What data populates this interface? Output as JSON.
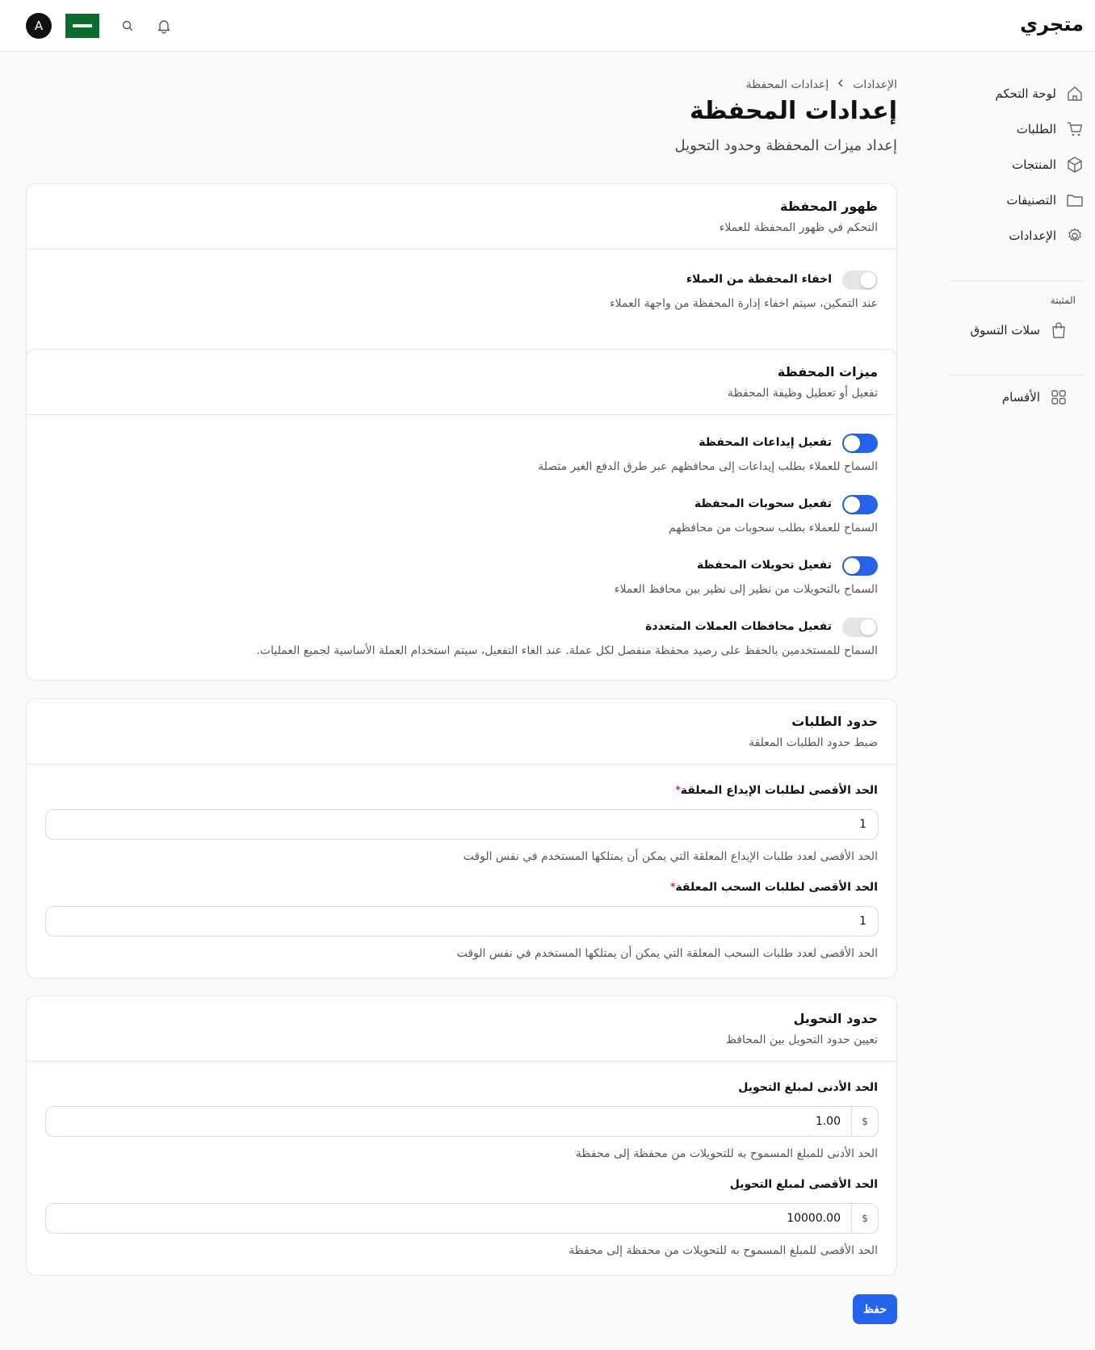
{
  "topbar": {
    "brand": "متجري",
    "avatar_letter": "A"
  },
  "sidebar": {
    "items": [
      {
        "label": "لوحة التحكم",
        "icon": "home-icon"
      },
      {
        "label": "الطلبات",
        "icon": "cart-icon"
      },
      {
        "label": "المنتجات",
        "icon": "box-icon"
      },
      {
        "label": "التصنيفات",
        "icon": "folder-icon"
      },
      {
        "label": "الإعدادات",
        "icon": "gear-icon"
      }
    ],
    "pinned_heading": "المثبتة",
    "pinned_items": [
      {
        "label": "سلات التسوق",
        "icon": "shopping-bag-icon"
      }
    ],
    "sections_item": {
      "label": "الأقسام",
      "icon": "grid-icon"
    }
  },
  "breadcrumb": {
    "parent": "الإعدادات",
    "current": "إعدادات المحفظة"
  },
  "page": {
    "title": "إعدادات المحفظة",
    "subtitle": "إعداد ميزات المحفظة وحدود التحويل"
  },
  "visibility_card": {
    "title": "ظهور المحفظة",
    "subtitle": "التحكم في ظهور المحفظة للعملاء",
    "hide_label": "اخفاء المحفظة من العملاء",
    "hide_desc": "عند التمكين، سيتم اخفاء إدارة المحفظة من واجهة العملاء",
    "hide_enabled": false
  },
  "features_card": {
    "title": "ميزات المحفظة",
    "subtitle": "تفعيل أو تعطيل وظيفة المحفظة",
    "items": [
      {
        "label": "تفعيل إيداعات المحفظة",
        "desc": "السماح للعملاء بطلب إيداعات إلى محافظهم عبر طرق الدفع الغير متصلة",
        "enabled": true
      },
      {
        "label": "تفعيل سحوبات المحفظة",
        "desc": "السماح للعملاء بطلب سحوبات من محافظهم",
        "enabled": true
      },
      {
        "label": "تفعيل تحويلات المحفظة",
        "desc": "السماح بالتحويلات من نظير إلى نظير بين محافظ العملاء",
        "enabled": true
      },
      {
        "label": "تفعيل محافظات العملات المتعددة",
        "desc": "السماح للمستخدمين بالحفظ على رصيد محفظة منفصل لكل عملة. عند الغاء التفعيل، سيتم استخدام العملة الأساسية لجميع العمليات.",
        "enabled": false
      }
    ]
  },
  "requests_card": {
    "title": "حدود الطلبات",
    "subtitle": "ضبط حدود الطلبات المعلقة",
    "deposit_label": "الحد الأقصى لطلبات الإيداع المعلقة",
    "deposit_value": "1",
    "deposit_help": "الحد الأقصى لعدد طلبات الإيداع المعلقة التي يمكن أن يمتلكها المستخدم في نفس الوقت",
    "withdraw_label": "الحد الأقصى لطلبات السحب المعلقة",
    "withdraw_value": "1",
    "withdraw_help": "الحد الأقصى لعدد طلبات السحب المعلقة التي يمكن أن يمتلكها المستخدم في نفس الوقت",
    "required_mark": "*"
  },
  "transfer_card": {
    "title": "حدود التحويل",
    "subtitle": "تعيين حدود التحويل بين المحافظ",
    "currency_symbol": "$",
    "min_label": "الحد الأدنى لمبلغ التحويل",
    "min_value": "1.00",
    "min_help": "الحد الأدنى للمبلغ المسموح به للتحويلات من محفظة إلى محفظة",
    "max_label": "الحد الأقصى لمبلغ التحويل",
    "max_value": "10000.00",
    "max_help": "الحد الأقصى للمبلغ المسموح به للتحويلات من محفظة إلى محفظة"
  },
  "actions": {
    "save_label": "حفظ"
  },
  "colors": {
    "primary": "#2563eb",
    "flag_green": "#0c6b2e",
    "toggle_off": "#e5e5e5"
  }
}
